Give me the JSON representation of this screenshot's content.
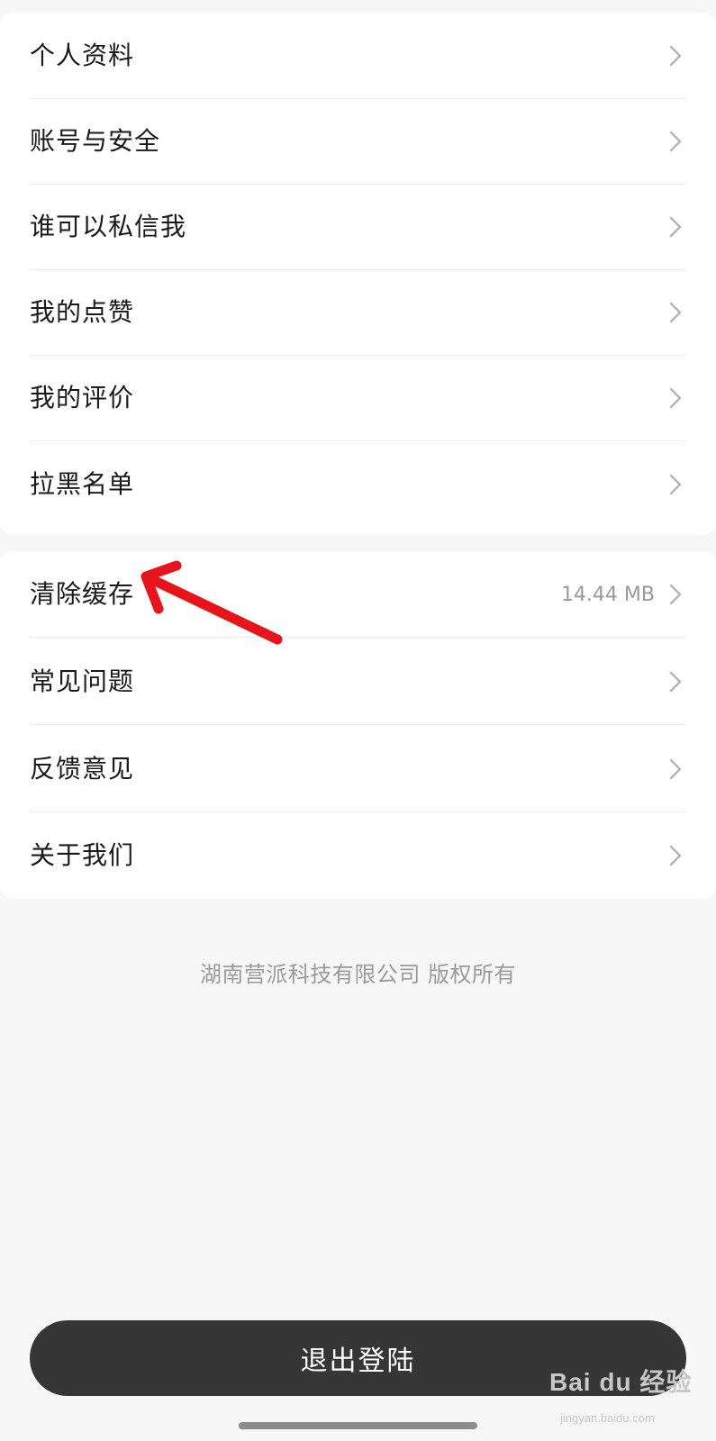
{
  "settings_group_1": [
    {
      "label": "个人资料"
    },
    {
      "label": "账号与安全"
    },
    {
      "label": "谁可以私信我"
    },
    {
      "label": "我的点赞"
    },
    {
      "label": "我的评价"
    },
    {
      "label": "拉黑名单"
    }
  ],
  "settings_group_2": [
    {
      "label": "清除缓存",
      "value": "14.44 MB"
    },
    {
      "label": "常见问题"
    },
    {
      "label": "反馈意见"
    },
    {
      "label": "关于我们"
    }
  ],
  "copyright": "湖南营派科技有限公司 版权所有",
  "logout_label": "退出登陆",
  "watermark": {
    "brand": "Bai du 经验",
    "site": "jingyan.baidu.com"
  },
  "colors": {
    "background": "#f7f7f7",
    "card": "#ffffff",
    "button": "#363636",
    "annotation_arrow": "#e8141b",
    "muted_text": "#9a9a9a"
  },
  "icons": {
    "row_chevron": "chevron-right-icon",
    "annotation": "red-arrow"
  }
}
